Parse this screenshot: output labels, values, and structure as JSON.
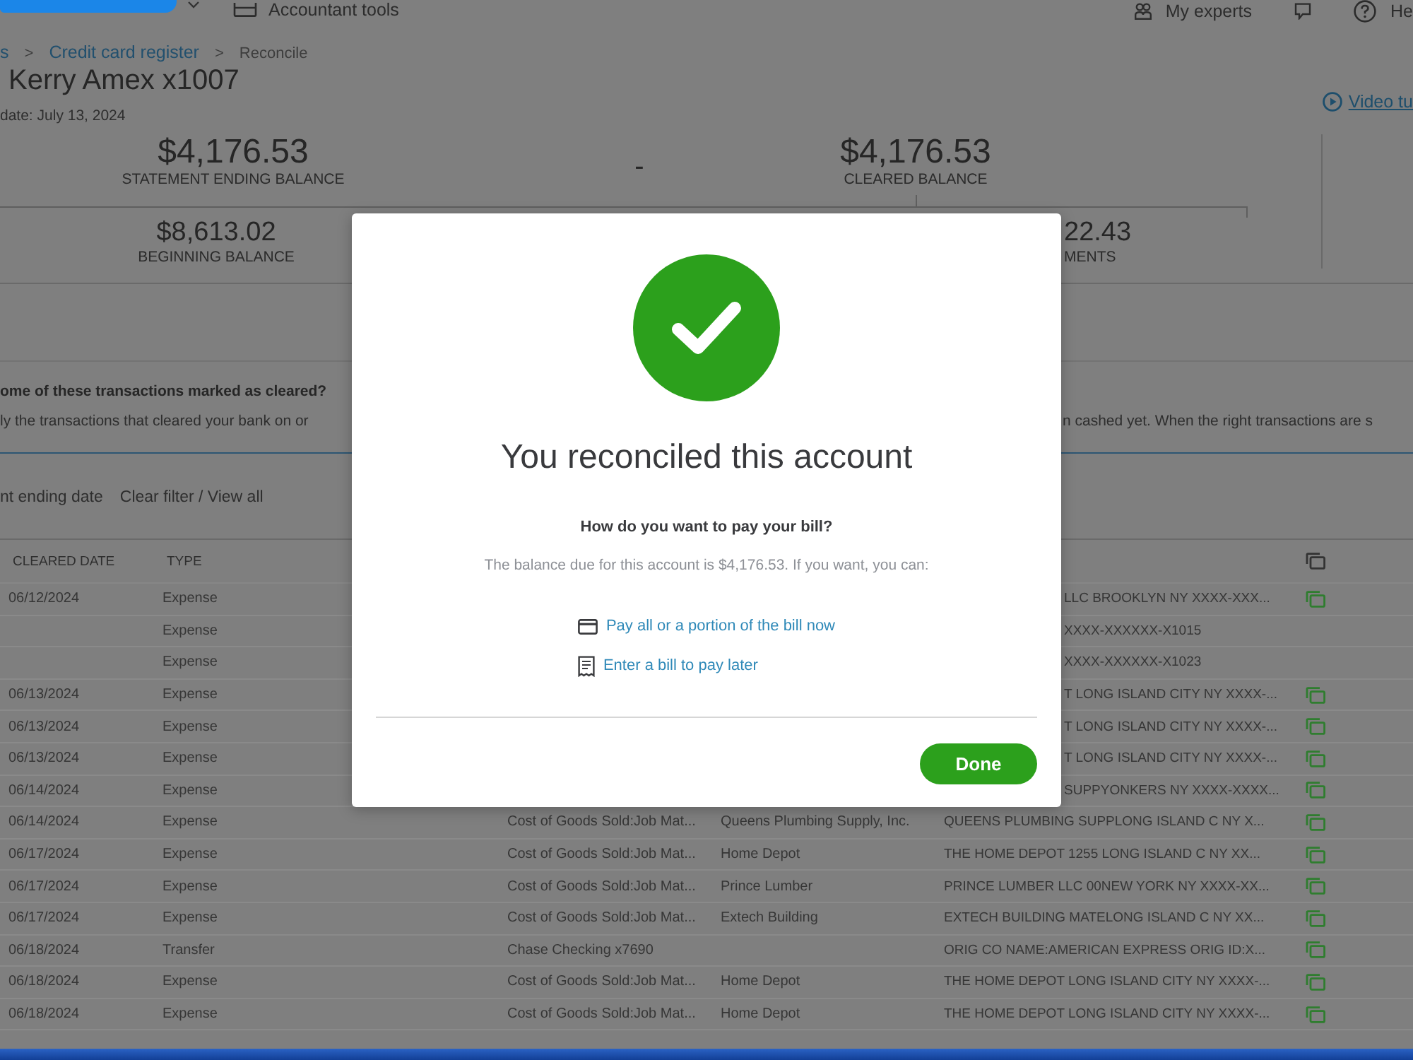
{
  "top_nav": {
    "left": [
      {
        "kind": "tools",
        "label": "Accountant tools"
      }
    ],
    "right": [
      {
        "kind": "experts",
        "label": "My experts"
      },
      {
        "kind": "feedback"
      },
      {
        "kind": "help",
        "label": "He"
      }
    ]
  },
  "breadcrumb": [
    {
      "kind": "link",
      "label": "s"
    },
    {
      "kind": "separator",
      "label": ">"
    },
    {
      "kind": "link",
      "label": "Credit card register"
    },
    {
      "kind": "separator",
      "label": ">"
    },
    {
      "kind": "current",
      "label": "Reconcile"
    }
  ],
  "title": "Kerry Amex x1007",
  "statement_date": "date: July 13, 2024",
  "video_link": "Video tu",
  "summary": {
    "top": [
      {
        "kind": "amount",
        "value": "$4,176.53",
        "label": "STATEMENT ENDING BALANCE"
      },
      {
        "kind": "operator",
        "value": "-"
      },
      {
        "kind": "amount",
        "value": "$4,176.53",
        "label": "CLEARED BALANCE"
      }
    ],
    "bottom": [
      {
        "value": "$8,613.02",
        "label": "BEGINNING BALANCE"
      },
      {
        "value": "22.43",
        "label": "MENTS"
      }
    ]
  },
  "notice": {
    "heading": "ome of these transactions marked as cleared?",
    "text_parts": [
      "ly the transactions that cleared your bank on or",
      "n cashed yet. When the right transactions are s"
    ]
  },
  "filter": {
    "label": "nt ending date",
    "link": "Clear filter / View all"
  },
  "table": {
    "columns": [
      "CLEARED DATE",
      "TYPE"
    ],
    "rows": [
      {
        "date": "06/12/2024",
        "type": "Expense",
        "memo": "LLC BROOKLYN NY XXXX-XXX...",
        "has_icon": true
      },
      {
        "type": "Expense",
        "memo": "XXXX-XXXXXX-X1015",
        "has_icon": false
      },
      {
        "type": "Expense",
        "memo": "XXXX-XXXXXX-X1023",
        "has_icon": false
      },
      {
        "date": "06/13/2024",
        "type": "Expense",
        "memo": "T LONG ISLAND CITY NY XXXX-...",
        "has_icon": true
      },
      {
        "date": "06/13/2024",
        "type": "Expense",
        "memo": "T LONG ISLAND CITY NY XXXX-...",
        "has_icon": true
      },
      {
        "date": "06/13/2024",
        "type": "Expense",
        "memo": "T LONG ISLAND CITY NY XXXX-...",
        "has_icon": true
      },
      {
        "date": "06/14/2024",
        "type": "Expense",
        "memo": "SUPPYONKERS NY XXXX-XXXX...",
        "has_icon": true
      },
      {
        "date": "06/14/2024",
        "type": "Expense",
        "account": "Cost of Goods Sold:Job Mat...",
        "payee": "Queens Plumbing Supply, Inc.",
        "memo": "QUEENS PLUMBING SUPPLONG ISLAND C NY X...",
        "has_icon": true
      },
      {
        "date": "06/17/2024",
        "type": "Expense",
        "account": "Cost of Goods Sold:Job Mat...",
        "payee": "Home Depot",
        "memo": "THE HOME DEPOT 1255 LONG ISLAND C NY XX...",
        "has_icon": true
      },
      {
        "date": "06/17/2024",
        "type": "Expense",
        "account": "Cost of Goods Sold:Job Mat...",
        "payee": "Prince Lumber",
        "memo": "PRINCE LUMBER LLC 00NEW YORK NY XXXX-XX...",
        "has_icon": true
      },
      {
        "date": "06/17/2024",
        "type": "Expense",
        "account": "Cost of Goods Sold:Job Mat...",
        "payee": "Extech Building",
        "memo": "EXTECH BUILDING MATELONG ISLAND C NY XX...",
        "has_icon": true
      },
      {
        "date": "06/18/2024",
        "type": "Transfer",
        "account": "Chase Checking x7690",
        "memo": "ORIG CO NAME:AMERICAN EXPRESS ORIG ID:X...",
        "has_icon": true
      },
      {
        "date": "06/18/2024",
        "type": "Expense",
        "account": "Cost of Goods Sold:Job Mat...",
        "payee": "Home Depot",
        "memo": "THE HOME DEPOT LONG ISLAND CITY NY XXXX-...",
        "has_icon": true
      },
      {
        "date": "06/18/2024",
        "type": "Expense",
        "account": "Cost of Goods Sold:Job Mat...",
        "payee": "Home Depot",
        "memo": "THE HOME DEPOT LONG ISLAND CITY NY XXXX-...",
        "has_icon": true
      }
    ]
  },
  "dialog": {
    "title": "You reconciled this account",
    "question": "How do you want to pay your bill?",
    "message": "The balance due for this account is $4,176.53. If you want, you can:",
    "options": [
      {
        "kind": "card",
        "label": "Pay all or a portion of the bill now"
      },
      {
        "kind": "bill",
        "label": "Enter a bill to pay later"
      }
    ],
    "done_button": "Done"
  }
}
